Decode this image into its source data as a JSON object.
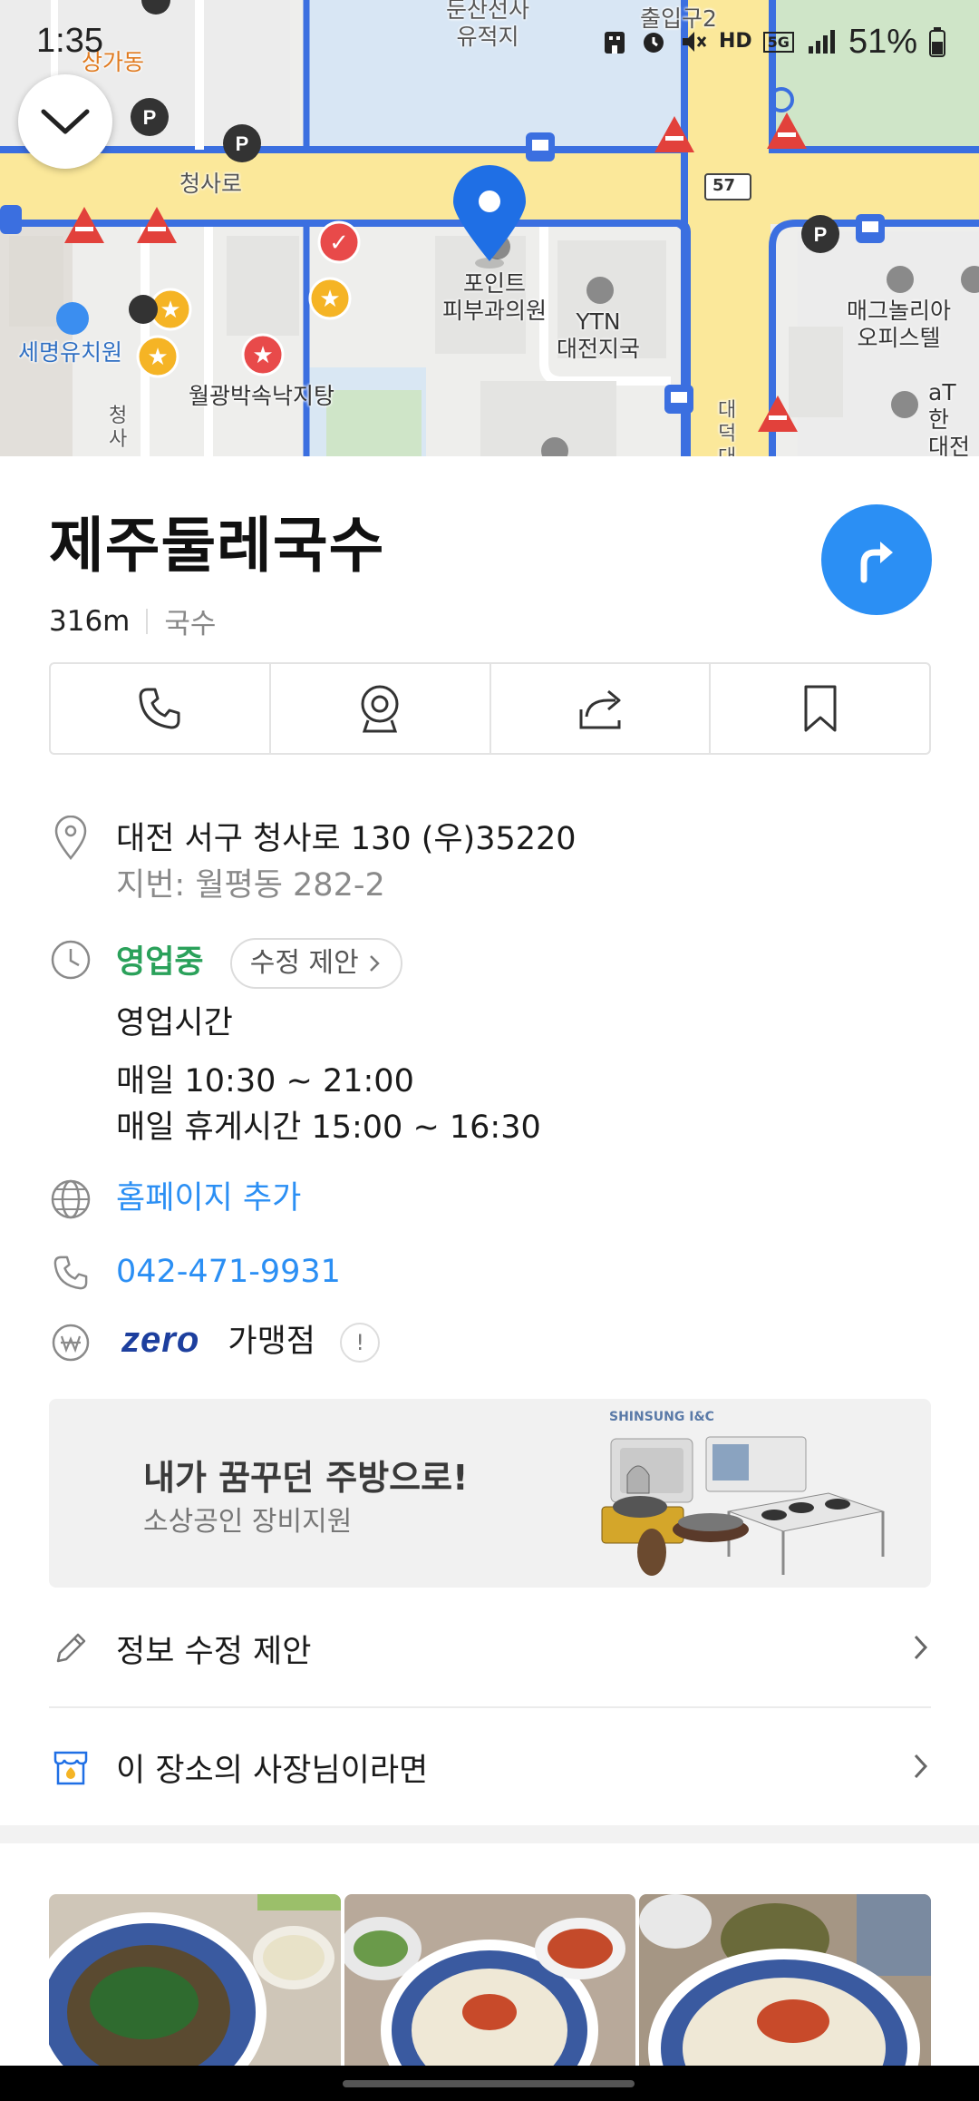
{
  "status_bar": {
    "time": "1:35",
    "network": "5G",
    "hd_voice": "HD",
    "battery": "51%"
  },
  "map": {
    "labels": {
      "dunsan": "둔산선사\n유적지",
      "exit2": "출입구2",
      "sangga": "상가동",
      "cheongsaro": "청사로",
      "pointskin": "포인트\n피부과의원",
      "ytn": "YTN\n대전지국",
      "magnolia": "매그놀리아\n오피스텔",
      "daycare": "세명유치원",
      "restaurant": "월광박속낙지탕",
      "at": "aT 한\n대전시",
      "road57": "57",
      "daedeok": "대\n덕\n대",
      "cheongsa_v": "청\n사"
    }
  },
  "place": {
    "name": "제주둘레국수",
    "distance": "316m",
    "category": "국수"
  },
  "actions": [
    "phone-icon",
    "roadview-icon",
    "share-icon",
    "bookmark-icon"
  ],
  "info": {
    "address": "대전 서구 청사로 130 (우)35220",
    "lot_address": "지번: 월평동 282-2",
    "open_status": "영업중",
    "suggest_edit": "수정 제안",
    "hours_title": "영업시간",
    "hours_daily": "매일 10:30 ~ 21:00",
    "hours_break": "매일 휴게시간 15:00 ~ 16:30",
    "homepage": "홈페이지 추가",
    "phone": "042-471-9931",
    "zeropay_logo": "zero",
    "zeropay_label": "가맹점"
  },
  "ad": {
    "brand": "SHINSUNG I&C",
    "title": "내가 꿈꾸던 주방으로!",
    "subtitle": "소상공인 장비지원"
  },
  "menu": {
    "edit_suggest": "정보 수정 제안",
    "owner": "이 장소의 사장님이라면"
  },
  "colors": {
    "accent_blue": "#2b8ff4",
    "open_green": "#2aa15a",
    "road_blue": "#3b6fe0",
    "road_yellow": "#fbe89a"
  }
}
